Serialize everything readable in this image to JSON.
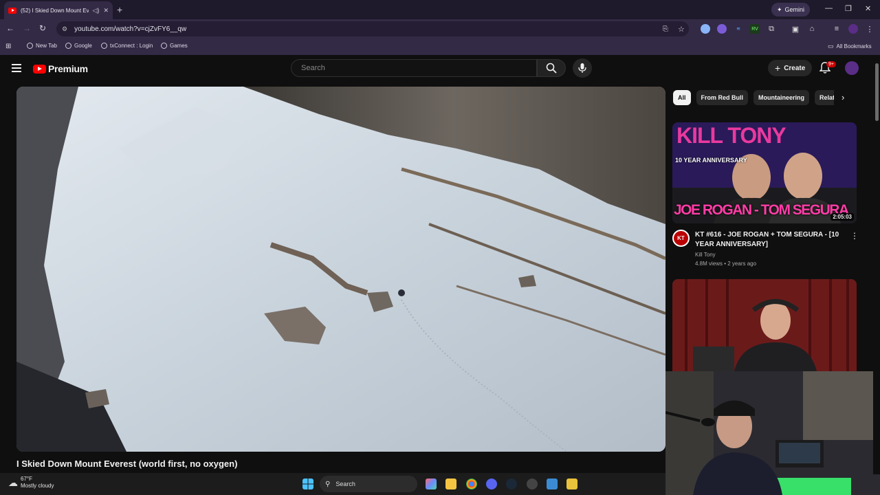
{
  "browser": {
    "tab_title": "(52) I Skied Down Mount Ev",
    "new_tab_symbol": "+",
    "gemini_label": "Gemini",
    "url": "youtube.com/watch?v=cjZvFY6__qw",
    "bookmarks": [
      "New Tab",
      "Google",
      "txConnect : Login",
      "Games"
    ],
    "all_bookmarks_label": "All Bookmarks",
    "extension_labels": {
      "rev": "RV"
    }
  },
  "youtube": {
    "logo_text": "Premium",
    "search_placeholder": "Search",
    "create_label": "Create",
    "notification_count": "9+",
    "chips": [
      "All",
      "From Red Bull",
      "Mountaineering",
      "Relate"
    ],
    "video_title": "I Skied Down Mount Everest (world first, no oxygen)",
    "recommendations": [
      {
        "title": "KT #616 - JOE ROGAN + TOM SEGURA - [10 YEAR ANNIVERSARY]",
        "channel": "Kill Tony",
        "channel_avatar_text": "KT",
        "meta": "4.8M views • 2 years ago",
        "duration": "2:05:03",
        "thumb_top_text": "KILL TONY",
        "thumb_sub_text": "10 YEAR ANNIVERSARY",
        "thumb_bottom_text": "JOE ROGAN - TOM SEGURA"
      }
    ]
  },
  "taskbar": {
    "temperature": "67°F",
    "condition": "Mostly cloudy",
    "search_label": "Search"
  },
  "colors": {
    "yt_red": "#ff0000",
    "chrome_bg": "#332a45",
    "page_bg": "#0f0f0f"
  }
}
